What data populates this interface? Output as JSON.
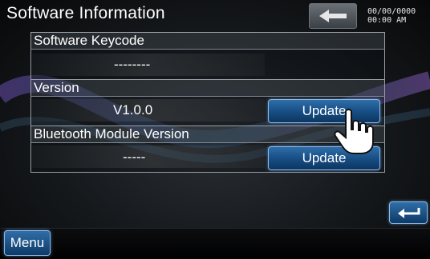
{
  "title": "Software Information",
  "datetime": {
    "date": "00/00/0000",
    "time": "00:00 AM"
  },
  "sections": [
    {
      "label": "Software Keycode",
      "value": "--------"
    },
    {
      "label": "Version",
      "value": "V1.0.0",
      "button": "Update"
    },
    {
      "label": "Bluetooth Module Version",
      "value": "-----",
      "button": "Update"
    }
  ],
  "menu_label": "Menu",
  "icons": {
    "back": "arrow-left-icon",
    "return": "return-arrow-icon",
    "cursor": "hand-pointer-icon"
  },
  "colors": {
    "button_blue": "#184f86",
    "button_border": "#8fb9e6",
    "text": "#ffffff"
  }
}
